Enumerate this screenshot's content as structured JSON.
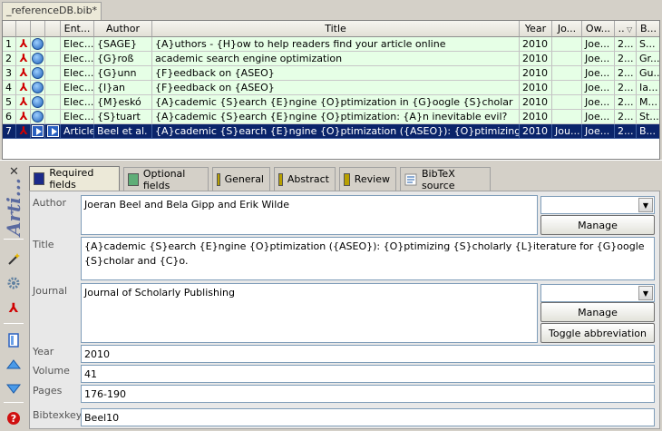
{
  "file_tab": "_referenceDB.bib*",
  "table": {
    "headers": [
      "",
      "",
      "",
      "Ent...",
      "Author",
      "Title",
      "Year",
      "Jo...",
      "Ow...",
      "..",
      "B..."
    ],
    "rows": [
      {
        "num": "1",
        "type": "Elec...",
        "author": "{SAGE}",
        "title": "{A}uthors - {H}ow to help readers find your article online",
        "year": "2010",
        "journal": "",
        "owner": "Joe...",
        "x": "2...",
        "b": "S...",
        "style": "green",
        "icon3": "url"
      },
      {
        "num": "2",
        "type": "Elec...",
        "author": "{G}roß",
        "title": "academic search engine optimization",
        "year": "2010",
        "journal": "",
        "owner": "Joe...",
        "x": "2...",
        "b": "Gr...",
        "style": "green",
        "icon3": "url"
      },
      {
        "num": "3",
        "type": "Elec...",
        "author": "{G}unn",
        "title": "{F}eedback on {ASEO}",
        "year": "2010",
        "journal": "",
        "owner": "Joe...",
        "x": "2...",
        "b": "Gu...",
        "style": "green",
        "icon3": "url"
      },
      {
        "num": "4",
        "type": "Elec...",
        "author": "{I}an",
        "title": "{F}eedback on {ASEO}",
        "year": "2010",
        "journal": "",
        "owner": "Joe...",
        "x": "2...",
        "b": "Ia...",
        "style": "green",
        "icon3": "url"
      },
      {
        "num": "5",
        "type": "Elec...",
        "author": "{M}eskó",
        "title": "{A}cademic {S}earch {E}ngine {O}ptimization in {G}oogle {S}cholar",
        "year": "2010",
        "journal": "",
        "owner": "Joe...",
        "x": "2...",
        "b": "M...",
        "style": "green",
        "icon3": "url"
      },
      {
        "num": "6",
        "type": "Elec...",
        "author": "{S}tuart",
        "title": "{A}cademic {S}earch {E}ngine {O}ptimization: {A}n inevitable evil?",
        "year": "2010",
        "journal": "",
        "owner": "Joe...",
        "x": "2...",
        "b": "St...",
        "style": "green",
        "icon3": "url"
      },
      {
        "num": "7",
        "type": "Article",
        "author": "Beel et al.",
        "title": "{A}cademic {S}earch {E}ngine {O}ptimization ({ASEO}): {O}ptimizing {S}c...",
        "year": "2010",
        "journal": "Jou...",
        "owner": "Joe...",
        "x": "2...",
        "b": "B...",
        "style": "selected",
        "icon3": "doi"
      }
    ]
  },
  "sidebar": {
    "title": "Arti..."
  },
  "tabs": [
    {
      "label": "Required fields",
      "color": "#1c2b8a"
    },
    {
      "label": "Optional fields",
      "color": "#5fae78"
    },
    {
      "label": "General",
      "color": "#b8a000"
    },
    {
      "label": "Abstract",
      "color": "#b8a000"
    },
    {
      "label": "Review",
      "color": "#b8a000"
    },
    {
      "label": "BibTeX source",
      "color": ""
    }
  ],
  "fields": {
    "author": {
      "label": "Author",
      "value": "Joeran Beel and Bela Gipp and Erik Wilde"
    },
    "title": {
      "label": "Title",
      "value": "{A}cademic {S}earch {E}ngine {O}ptimization ({ASEO}): {O}ptimizing {S}cholarly {L}iterature for {G}oogle {S}cholar and {C}o."
    },
    "journal": {
      "label": "Journal",
      "value": "Journal of Scholarly Publishing"
    },
    "year": {
      "label": "Year",
      "value": "2010"
    },
    "volume": {
      "label": "Volume",
      "value": "41"
    },
    "pages": {
      "label": "Pages",
      "value": "176-190"
    },
    "bibtexkey": {
      "label": "Bibtexkey",
      "value": "Beel10"
    }
  },
  "buttons": {
    "manage": "Manage",
    "toggle": "Toggle abbreviation"
  }
}
